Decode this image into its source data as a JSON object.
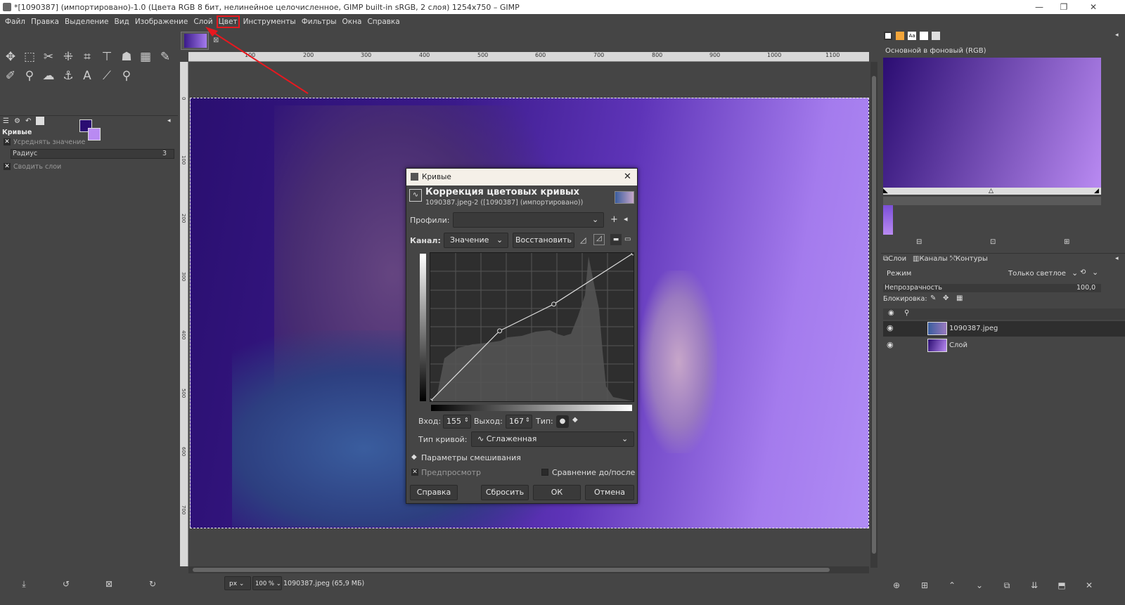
{
  "window": {
    "title": "*[1090387] (импортировано)-1.0 (Цвета RGB 8 бит, нелинейное целочисленное, GIMP built-in sRGB, 2 слоя) 1254x750 – GIMP"
  },
  "menubar": {
    "items": [
      "Файл",
      "Правка",
      "Выделение",
      "Вид",
      "Изображение",
      "Слой",
      "Цвет",
      "Инструменты",
      "Фильтры",
      "Окна",
      "Справка"
    ]
  },
  "tool_options": {
    "title": "Кривые",
    "average_label": "Усреднять значение",
    "radius_label": "Радиус",
    "radius_value": "3",
    "merge_layers_label": "Сводить слои"
  },
  "rulers": {
    "h_ticks": [
      "100",
      "200",
      "300",
      "400",
      "500",
      "600",
      "700",
      "800",
      "900",
      "1000",
      "1100"
    ],
    "v_ticks": [
      "0",
      "100",
      "200",
      "300",
      "400",
      "500",
      "600",
      "700"
    ]
  },
  "dialog": {
    "window_title": "Кривые",
    "heading": "Коррекция цветовых кривых",
    "subheading": "1090387.jpeg-2 ([1090387] (импортировано))",
    "presets_label": "Профили:",
    "presets_value": "",
    "channel_label": "Канал:",
    "channel_value": "Значение",
    "reset_channel": "Восстановить",
    "input_label": "Вход:",
    "input_value": "155",
    "output_label": "Выход:",
    "output_value": "167",
    "type_label": "Тип:",
    "curve_type_label": "Тип кривой:",
    "curve_type_value": "Сглаженная",
    "blending_label": "Параметры смешивания",
    "preview_label": "Предпросмотр",
    "split_label": "Сравнение до/после",
    "help_btn": "Справка",
    "reset_btn": "Сбросить",
    "ok_btn": "ОК",
    "cancel_btn": "Отмена",
    "curve_points": [
      [
        0,
        0
      ],
      [
        87,
        121
      ],
      [
        155,
        167
      ],
      [
        255,
        255
      ]
    ]
  },
  "gradient_panel": {
    "title": "Основной в фоновый (RGB)"
  },
  "layers_panel": {
    "tabs": [
      "Слои",
      "Каналы",
      "Контуры"
    ],
    "mode_label": "Режим",
    "mode_value": "Только светлое",
    "opacity_label": "Непрозрачность",
    "opacity_value": "100,0",
    "lock_label": "Блокировка:",
    "layers": [
      {
        "name": "1090387.jpeg"
      },
      {
        "name": "Слой"
      }
    ]
  },
  "statusbar": {
    "unit": "px",
    "zoom": "100 %",
    "info": "1090387.jpeg (65,9 МБ)"
  },
  "colors": {
    "foreground": "#2b0d72",
    "background": "#b98af2",
    "highlight": "#e8181f"
  }
}
